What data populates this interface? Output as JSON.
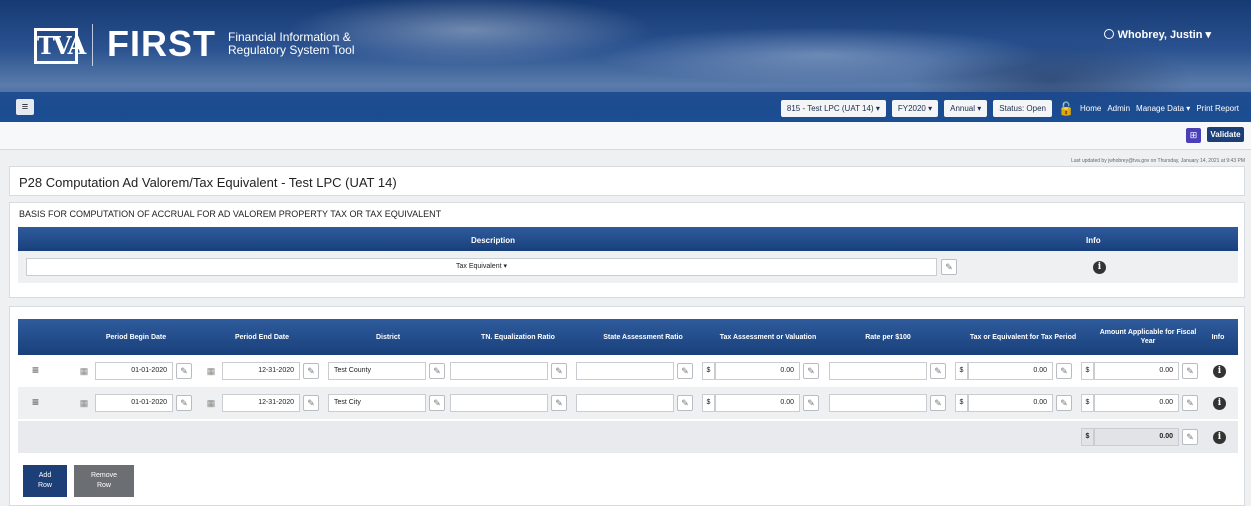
{
  "header": {
    "logo_mark": "TVA",
    "app_name": "FIRST",
    "app_subtitle_1": "Financial Information &",
    "app_subtitle_2": "Regulatory System Tool",
    "user": "Whobrey, Justin",
    "menu_icon": "hamburger-icon"
  },
  "nav": {
    "entity": "815 - Test LPC (UAT 14)",
    "fiscal_year": "FY2020",
    "period": "Annual",
    "status": "Status: Open",
    "links": [
      "Home",
      "Admin",
      "Manage Data",
      "Print Report"
    ]
  },
  "toolbar": {
    "validate_label": "Validate",
    "last_updated": "Last updated by jwhobrey@tva.gov on Thursday, January 14, 2021 at 9:43 PM"
  },
  "page": {
    "title": "P28 Computation Ad Valorem/Tax Equivalent - Test LPC (UAT 14)"
  },
  "basis": {
    "title": "BASIS FOR COMPUTATION OF ACCRUAL FOR AD VALOREM PROPERTY TAX OR TAX EQUIVALENT",
    "col_description": "Description",
    "col_info": "Info",
    "description_value": "Tax Equivalent"
  },
  "table": {
    "headers": {
      "begin": "Period Begin Date",
      "end": "Period End Date",
      "district": "District",
      "tn_ratio": "TN. Equalization Ratio",
      "state_ratio": "State Assessment Ratio",
      "assessment": "Tax Assessment or Valuation",
      "rate": "Rate per $100",
      "tax_period": "Tax or Equivalent for Tax Period",
      "fiscal": "Amount Applicable for Fiscal Year",
      "info": "Info"
    },
    "rows": [
      {
        "begin": "01-01-2020",
        "end": "12-31-2020",
        "district": "Test County",
        "tn_ratio": "",
        "state_ratio": "",
        "assessment": "0.00",
        "rate": "",
        "tax_period": "0.00",
        "fiscal": "0.00"
      },
      {
        "begin": "01-01-2020",
        "end": "12-31-2020",
        "district": "Test City",
        "tn_ratio": "",
        "state_ratio": "",
        "assessment": "0.00",
        "rate": "",
        "tax_period": "0.00",
        "fiscal": "0.00"
      }
    ],
    "currency_symbol": "$",
    "total": "0.00"
  },
  "actions": {
    "add_row_1": "Add",
    "add_row_2": "Row",
    "remove_row_1": "Remove",
    "remove_row_2": "Row"
  },
  "colors": {
    "brand_navy": "#1c3f78",
    "header_blue": "#18407b",
    "remove_gray": "#6b6e72",
    "validate_icon": "#4a3fb8"
  }
}
